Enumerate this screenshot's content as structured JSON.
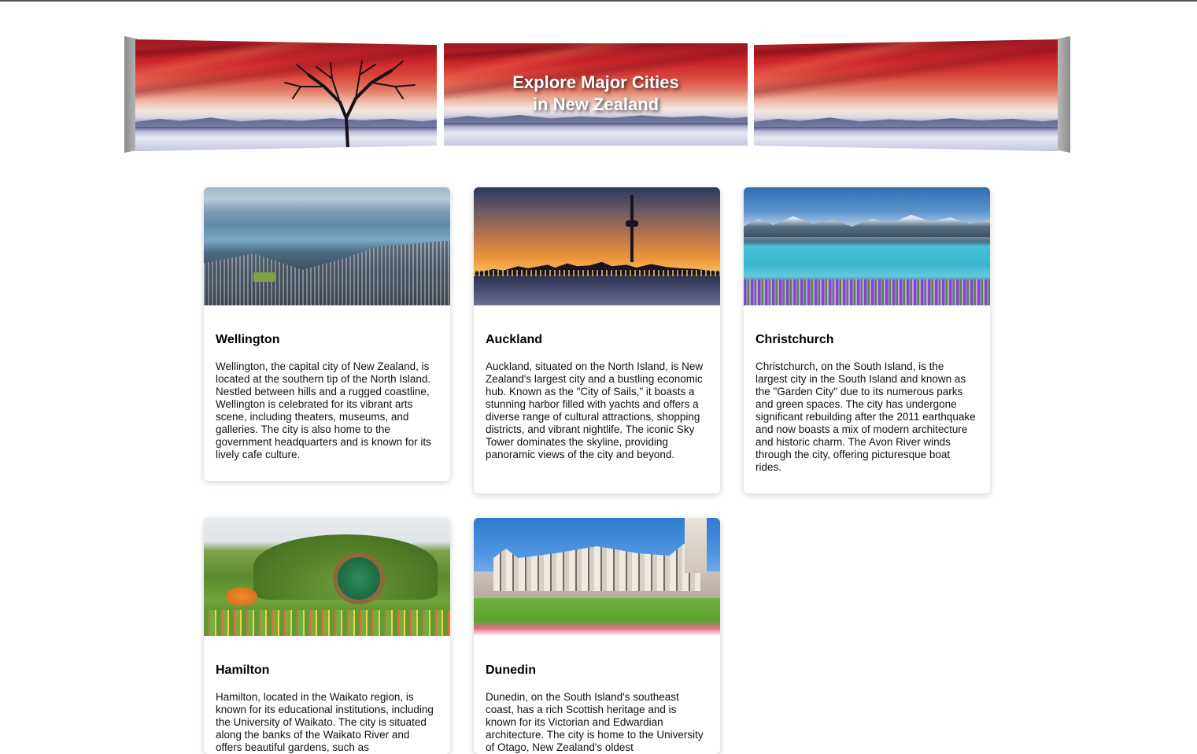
{
  "page": {
    "banner_title_line1": "Explore Major Cities",
    "banner_title_line2": "in New Zealand"
  },
  "cards": [
    {
      "image_name": "wellington-harbour-image",
      "title": "Wellington",
      "text": "Wellington, the capital city of New Zealand, is located at the southern tip of the North Island. Nestled between hills and a rugged coastline, Wellington is celebrated for its vibrant arts scene, including theaters, museums, and galleries. The city is also home to the government headquarters and is known for its lively cafe culture."
    },
    {
      "image_name": "auckland-skyline-image",
      "title": "Auckland",
      "text": "Auckland, situated on the North Island, is New Zealand's largest city and a bustling economic hub. Known as the \"City of Sails,\" it boasts a stunning harbor filled with yachts and offers a diverse range of cultural attractions, shopping districts, and vibrant nightlife. The iconic Sky Tower dominates the skyline, providing panoramic views of the city and beyond."
    },
    {
      "image_name": "christchurch-lake-image",
      "title": "Christchurch",
      "text": "Christchurch, on the South Island, is the largest city in the South Island and known as the \"Garden City\" due to its numerous parks and green spaces. The city has undergone significant rebuilding after the 2011 earthquake and now boasts a mix of modern architecture and historic charm. The Avon River winds through the city, offering picturesque boat rides."
    },
    {
      "image_name": "hamilton-hobbit-hole-image",
      "title": "Hamilton",
      "text": "Hamilton, located in the Waikato region, is known for its educational institutions, including the University of Waikato. The city is situated along the banks of the Waikato River and offers beautiful gardens, such as"
    },
    {
      "image_name": "dunedin-railway-station-image",
      "title": "Dunedin",
      "text": "Dunedin, on the South Island's southeast coast, has a rich Scottish heritage and is known for its Victorian and Edwardian architecture. The city is home to the University of Otago, New Zealand's oldest"
    }
  ]
}
